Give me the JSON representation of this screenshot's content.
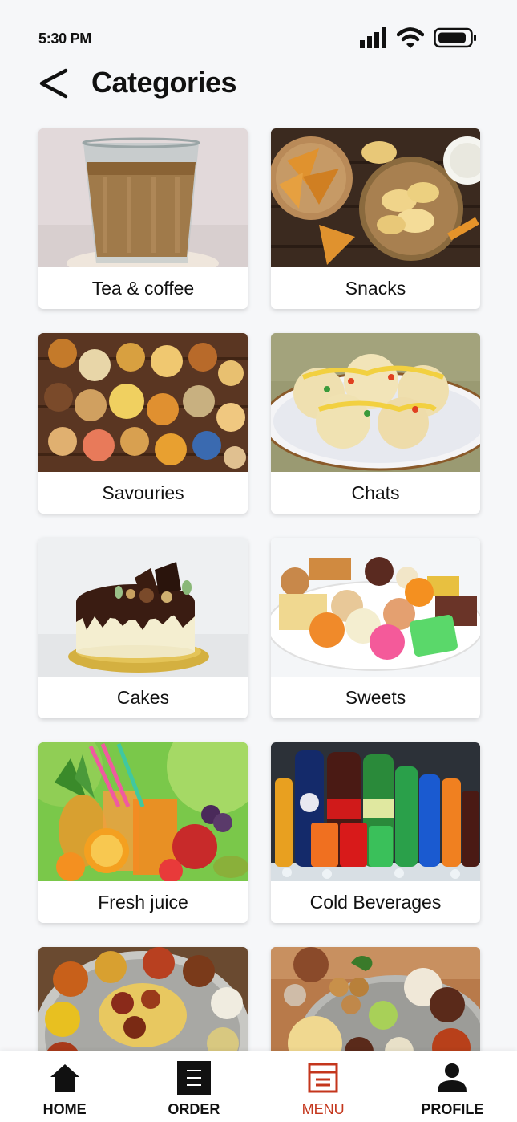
{
  "status": {
    "time": "5:30 PM"
  },
  "header": {
    "title": "Categories"
  },
  "categories": [
    {
      "label": "Tea & coffee"
    },
    {
      "label": "Snacks"
    },
    {
      "label": "Savouries"
    },
    {
      "label": "Chats"
    },
    {
      "label": "Cakes"
    },
    {
      "label": "Sweets"
    },
    {
      "label": "Fresh juice"
    },
    {
      "label": "Cold Beverages"
    },
    {
      "label": ""
    },
    {
      "label": ""
    }
  ],
  "nav": {
    "items": [
      {
        "label": "HOME",
        "icon": "home-icon"
      },
      {
        "label": "ORDER",
        "icon": "order-icon"
      },
      {
        "label": "MENU",
        "icon": "menu-icon"
      },
      {
        "label": "PROFILE",
        "icon": "profile-icon"
      }
    ],
    "active": "MENU",
    "active_color": "#c4361c"
  }
}
